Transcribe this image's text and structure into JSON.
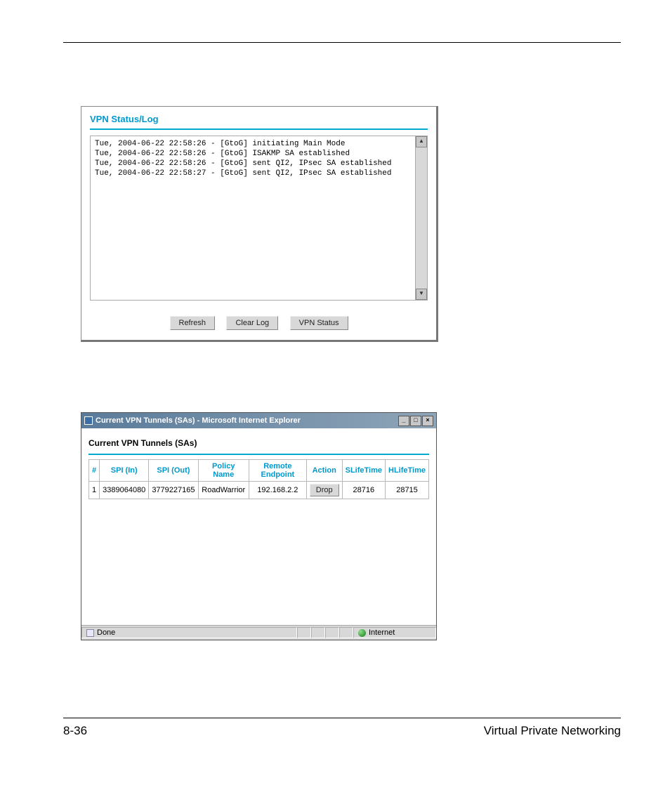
{
  "panel1": {
    "title": "VPN Status/Log",
    "log_lines": [
      "Tue, 2004-06-22 22:58:26 - [GtoG] initiating Main Mode",
      "Tue, 2004-06-22 22:58:26 - [GtoG] ISAKMP SA established",
      "Tue, 2004-06-22 22:58:26 - [GtoG] sent QI2, IPsec SA established",
      "Tue, 2004-06-22 22:58:27 - [GtoG] sent QI2, IPsec SA established"
    ],
    "buttons": {
      "refresh": "Refresh",
      "clear_log": "Clear Log",
      "vpn_status": "VPN Status"
    }
  },
  "panel2": {
    "window_title": "Current VPN Tunnels (SAs) - Microsoft Internet Explorer",
    "content_title": "Current VPN Tunnels (SAs)",
    "headers": {
      "num": "#",
      "spi_in": "SPI (In)",
      "spi_out": "SPI (Out)",
      "policy": "Policy Name",
      "remote": "Remote Endpoint",
      "action": "Action",
      "slife": "SLifeTime",
      "hlife": "HLifeTime"
    },
    "row": {
      "num": "1",
      "spi_in": "3389064080",
      "spi_out": "3779227165",
      "policy": "RoadWarrior",
      "remote": "192.168.2.2",
      "action_label": "Drop",
      "slife": "28716",
      "hlife": "28715"
    },
    "status": {
      "done": "Done",
      "zone": "Internet"
    }
  },
  "footer": {
    "page": "8-36",
    "chapter": "Virtual Private Networking"
  }
}
